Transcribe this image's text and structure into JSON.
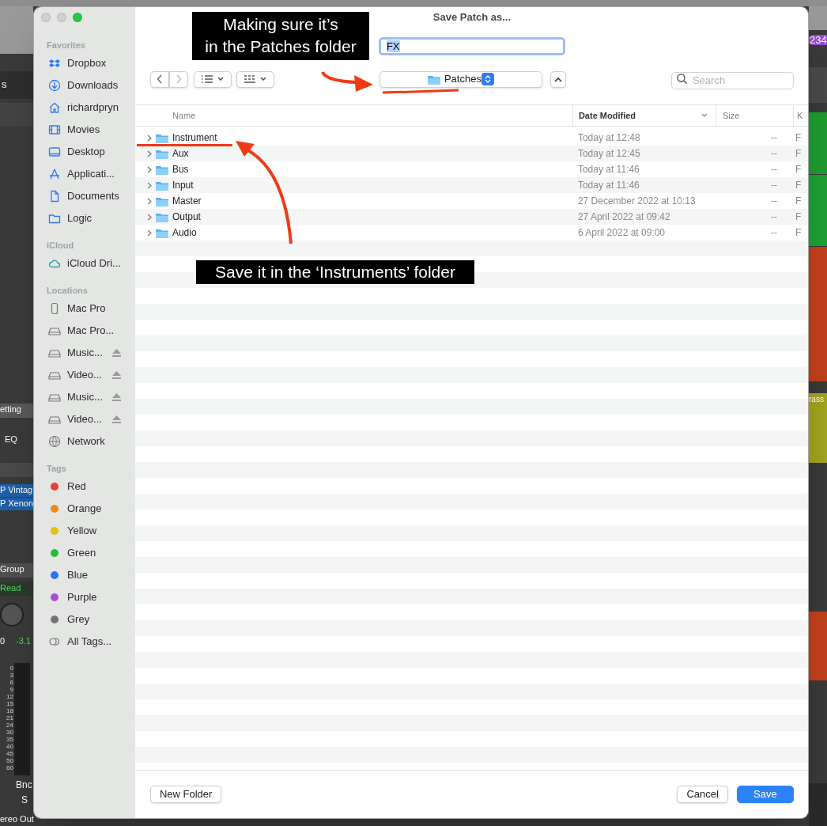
{
  "background_app": {
    "left_labels": [
      "s",
      "etting",
      "EQ",
      "P Vintag",
      "P Xenon",
      "Group",
      "Read",
      "0",
      "-3.1",
      "Bnc",
      "S",
      "ereo Out"
    ],
    "meter_scale": [
      "0",
      "3",
      "6",
      "9",
      "12",
      "15",
      "18",
      "21",
      "24",
      "30",
      "35",
      "40",
      "45",
      "50",
      "60"
    ],
    "right_labels": [
      "234",
      "rass"
    ]
  },
  "window": {
    "title": "Save Patch as..."
  },
  "sidebar": {
    "sections": [
      {
        "title": "Favorites",
        "items": [
          {
            "label": "Dropbox",
            "kind": "dropbox"
          },
          {
            "label": "Downloads",
            "kind": "download"
          },
          {
            "label": "richardpryn",
            "kind": "home"
          },
          {
            "label": "Movies",
            "kind": "film"
          },
          {
            "label": "Desktop",
            "kind": "desktop"
          },
          {
            "label": "Applicati...",
            "kind": "apps"
          },
          {
            "label": "Documents",
            "kind": "doc"
          },
          {
            "label": "Logic",
            "kind": "folder"
          }
        ]
      },
      {
        "title": "iCloud",
        "items": [
          {
            "label": "iCloud Dri...",
            "kind": "cloud"
          }
        ]
      },
      {
        "title": "Locations",
        "items": [
          {
            "label": "Mac Pro",
            "kind": "tower"
          },
          {
            "label": "Mac Pro...",
            "kind": "drive"
          },
          {
            "label": "Music...",
            "kind": "drive",
            "eject": true
          },
          {
            "label": "Video...",
            "kind": "drive",
            "eject": true
          },
          {
            "label": "Music...",
            "kind": "drive",
            "eject": true
          },
          {
            "label": "Video...",
            "kind": "drive",
            "eject": true
          },
          {
            "label": "Network",
            "kind": "globe"
          }
        ]
      },
      {
        "title": "Tags",
        "items": [
          {
            "label": "Red",
            "color": "#f23c33"
          },
          {
            "label": "Orange",
            "color": "#ef8a0e"
          },
          {
            "label": "Yellow",
            "color": "#e8c20b"
          },
          {
            "label": "Green",
            "color": "#22bf37"
          },
          {
            "label": "Blue",
            "color": "#2d72f3"
          },
          {
            "label": "Purple",
            "color": "#a94ed1"
          },
          {
            "label": "Grey",
            "color": "#737376"
          },
          {
            "label": "All Tags...",
            "kind": "tags"
          }
        ]
      }
    ]
  },
  "name_field": {
    "value": "FX"
  },
  "location_popup": {
    "label": "Patches"
  },
  "search": {
    "placeholder": "Search"
  },
  "table": {
    "columns": [
      {
        "label": "Name"
      },
      {
        "label": "Date Modified",
        "sorted": true
      },
      {
        "label": "Size"
      },
      {
        "label": "K"
      }
    ],
    "rows": [
      {
        "name": "Instrument",
        "date": "Today at 12:48",
        "size": "--",
        "column_4": "F"
      },
      {
        "name": "Aux",
        "date": "Today at 12:45",
        "size": "--",
        "column_4": "F"
      },
      {
        "name": "Bus",
        "date": "Today at 11:46",
        "size": "--",
        "column_4": "F"
      },
      {
        "name": "Input",
        "date": "Today at 11:46",
        "size": "--",
        "column_4": "F"
      },
      {
        "name": "Master",
        "date": "27 December 2022 at 10:13",
        "size": "--",
        "column_4": "F"
      },
      {
        "name": "Output",
        "date": "27 April 2022 at 09:42",
        "size": "--",
        "column_4": "F"
      },
      {
        "name": "Audio",
        "date": "6 April 2022 at 09:00",
        "size": "--",
        "column_4": "F"
      }
    ]
  },
  "buttons": [
    {
      "label": "New Folder",
      "kind": "secondary"
    },
    {
      "label": "Cancel",
      "kind": "secondary"
    },
    {
      "label": "Save",
      "kind": "primary"
    }
  ],
  "annotations": [
    {
      "text": "Making sure it’s\nin the Patches folder",
      "kind": "top"
    },
    {
      "text": "Save it in the ‘Instruments’ folder",
      "kind": "middle"
    }
  ]
}
